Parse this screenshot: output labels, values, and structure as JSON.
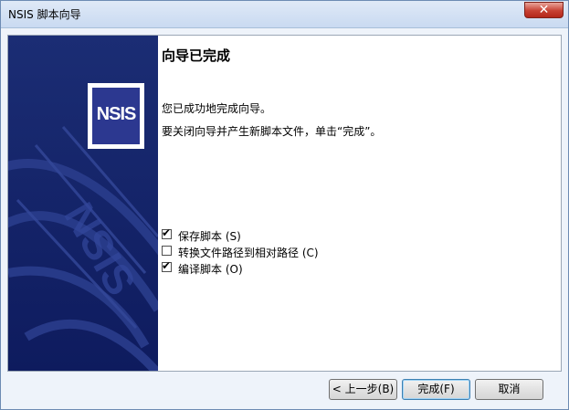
{
  "window": {
    "title": "NSIS 脚本向导"
  },
  "logo": {
    "text": "NSIS",
    "watermark": "NSIS"
  },
  "page": {
    "heading": "向导已完成",
    "line1": "您已成功地完成向导。",
    "line2": "要关闭向导并产生新脚本文件，单击“完成”。"
  },
  "options": [
    {
      "label": "保存脚本 (S)",
      "checked": true
    },
    {
      "label": "转换文件路径到相对路径 (C)",
      "checked": false
    },
    {
      "label": "编译脚本 (O)",
      "checked": true
    }
  ],
  "buttons": {
    "back": "< 上一步(B)",
    "finish": "完成(F)",
    "cancel": "取消"
  },
  "colors": {
    "side_panel": "#15246a",
    "logo_blue": "#2c3890",
    "close_red": "#c74133"
  }
}
